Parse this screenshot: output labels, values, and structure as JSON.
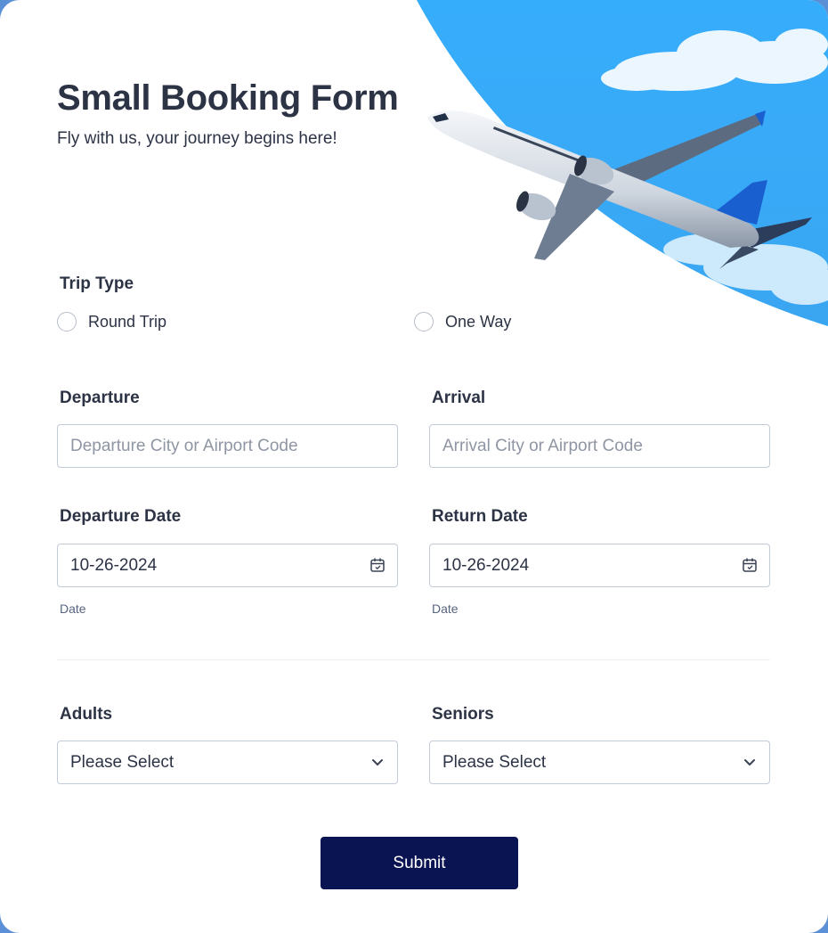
{
  "header": {
    "title": "Small Booking Form",
    "subtitle": "Fly with us, your journey begins here!"
  },
  "trip_type": {
    "label": "Trip Type",
    "options": [
      "Round Trip",
      "One Way"
    ],
    "selected": null
  },
  "departure": {
    "label": "Departure",
    "placeholder": "Departure City or Airport Code",
    "value": ""
  },
  "arrival": {
    "label": "Arrival",
    "placeholder": "Arrival City or Airport Code",
    "value": ""
  },
  "departure_date": {
    "label": "Departure Date",
    "value": "10-26-2024",
    "sublabel": "Date"
  },
  "return_date": {
    "label": "Return Date",
    "value": "10-26-2024",
    "sublabel": "Date"
  },
  "adults": {
    "label": "Adults",
    "value": "Please Select"
  },
  "seniors": {
    "label": "Seniors",
    "value": "Please Select"
  },
  "submit": {
    "label": "Submit"
  },
  "colors": {
    "sky": "#3ab0fb",
    "button": "#0b1452",
    "text": "#2c3345",
    "border": "#c3cad8",
    "tail": "#1a5fd0"
  }
}
